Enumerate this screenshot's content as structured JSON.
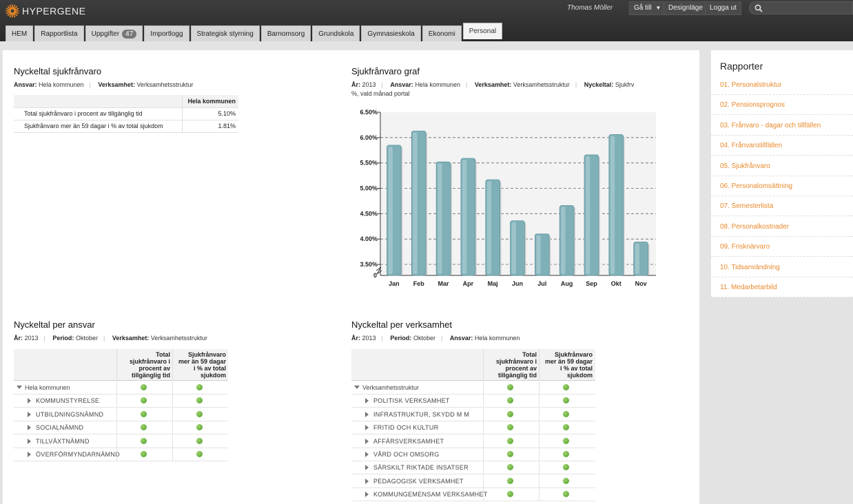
{
  "brand": {
    "name": "HYPERGENE",
    "logo": "asterisk-logo-icon"
  },
  "header": {
    "user": "Thomas Möller",
    "goto_label": "Gå till",
    "design_label": "Designläge",
    "logout_label": "Logga ut",
    "search_placeholder": ""
  },
  "tabs": [
    {
      "label": "HEM"
    },
    {
      "label": "Rapportlista"
    },
    {
      "label": "Uppgifter",
      "count": "47"
    },
    {
      "label": "Importlogg"
    },
    {
      "label": "Strategisk styrning"
    },
    {
      "label": "Barnomsorg"
    },
    {
      "label": "Grundskola"
    },
    {
      "label": "Gymnasieskola"
    },
    {
      "label": "Ekonomi"
    },
    {
      "label": "Personal",
      "active": true
    }
  ],
  "kpi": {
    "title": "Nyckeltal sjukfrånvaro",
    "meta": {
      "ansvar_label": "Ansvar:",
      "ansvar": "Hela kommunen",
      "verksamhet_label": "Verksamhet:",
      "verksamhet": "Verksamhetsstruktur"
    },
    "col_header": "Hela kommunen",
    "rows": [
      {
        "label": "Total sjukfrånvaro i procent av tillgänglig tid",
        "value": "5.10%"
      },
      {
        "label": "Sjukfrånvaro mer än 59 dagar i % av total sjukdom",
        "value": "1.81%"
      }
    ]
  },
  "graph": {
    "title": "Sjukfrånvaro graf",
    "meta": {
      "ar_label": "År:",
      "ar": "2013",
      "ansvar_label": "Ansvar:",
      "ansvar": "Hela kommunen",
      "verksamhet_label": "Verksamhet:",
      "verksamhet": "Verksamhetsstruktur",
      "nyckeltal_label": "Nyckeltal:",
      "nyckeltal_1": "Sjukfrv",
      "nyckeltal_2": "%, vald månad portal"
    }
  },
  "chart_data": {
    "type": "bar",
    "title": "Sjukfrånvaro graf",
    "categories": [
      "Jan",
      "Feb",
      "Mar",
      "Apr",
      "Maj",
      "Jun",
      "Jul",
      "Aug",
      "Sep",
      "Okt",
      "Nov"
    ],
    "values": [
      5.85,
      6.13,
      5.52,
      5.59,
      5.17,
      4.36,
      4.1,
      4.66,
      5.66,
      6.06,
      3.94
    ],
    "ylim": [
      3.5,
      6.5
    ],
    "yticks": [
      "6.50%",
      "6.00%",
      "5.50%",
      "5.00%",
      "4.50%",
      "4.00%",
      "3.50%",
      "0"
    ],
    "ytick_values": [
      6.5,
      6.0,
      5.5,
      5.0,
      4.5,
      4.0,
      3.5
    ],
    "axis_break": true,
    "grid": true,
    "bar_color": "#7fb0b8",
    "xlabel": "",
    "ylabel": ""
  },
  "per_ansvar": {
    "title": "Nyckeltal per ansvar",
    "meta": {
      "ar_label": "År:",
      "ar": "2013",
      "period_label": "Period:",
      "period": "Oktober",
      "verksamhet_label": "Verksamhet:",
      "verksamhet": "Verksamhetsstruktur"
    },
    "col1": [
      "Total",
      "sjukfrånvaro i",
      "procent av",
      "tillgänglig tid"
    ],
    "col2": [
      "Sjukfrånvaro",
      "mer än 59 dagar",
      "i % av total",
      "sjukdom"
    ],
    "root": "Hela kommunen",
    "rows": [
      "KOMMUNSTYRELSE",
      "UTBILDNINGSNÄMND",
      "SOCIALNÄMND",
      "TILLVÄXTNÄMND",
      "ÖVERFÖRMYNDARNÄMND"
    ],
    "status_color": "#5aab33"
  },
  "per_verksamhet": {
    "title": "Nyckeltal per verksamhet",
    "meta": {
      "ar_label": "År:",
      "ar": "2013",
      "period_label": "Period:",
      "period": "Oktober",
      "ansvar_label": "Ansvar:",
      "ansvar": "Hela kommunen"
    },
    "col1": [
      "Total",
      "sjukfrånvaro i",
      "procent av",
      "tillgänglig tid"
    ],
    "col2": [
      "Sjukfrånvaro",
      "mer än 59 dagar",
      "i % av total",
      "sjukdom"
    ],
    "root": "Verksamhetsstruktur",
    "rows": [
      "POLITISK VERKSAMHET",
      "INFRASTRUKTUR, SKYDD M M",
      "FRITID OCH KULTUR",
      "AFFÄRSVERKSAMHET",
      "VÅRD OCH OMSORG",
      "SÄRSKILT RIKTADE INSATSER",
      "PEDAGOGISK VERKSAMHET",
      "KOMMUNGEMENSAM VERKSAMHET"
    ]
  },
  "sidebar": {
    "title": "Rapporter",
    "link_color": "#e8892b",
    "items": [
      "01. Personalstruktur",
      "02. Pensionsprognos",
      "03. Frånvaro - dagar och tillfällen",
      "04. Frånvarotillfällen",
      "05. Sjukfrånvaro",
      "06. Personalomsättning",
      "07. Semesterlista",
      "08. Personalkostnader",
      "09. Frisknärvaro",
      "10. Tidsanvändning",
      "11. Medarbetarbild"
    ]
  }
}
